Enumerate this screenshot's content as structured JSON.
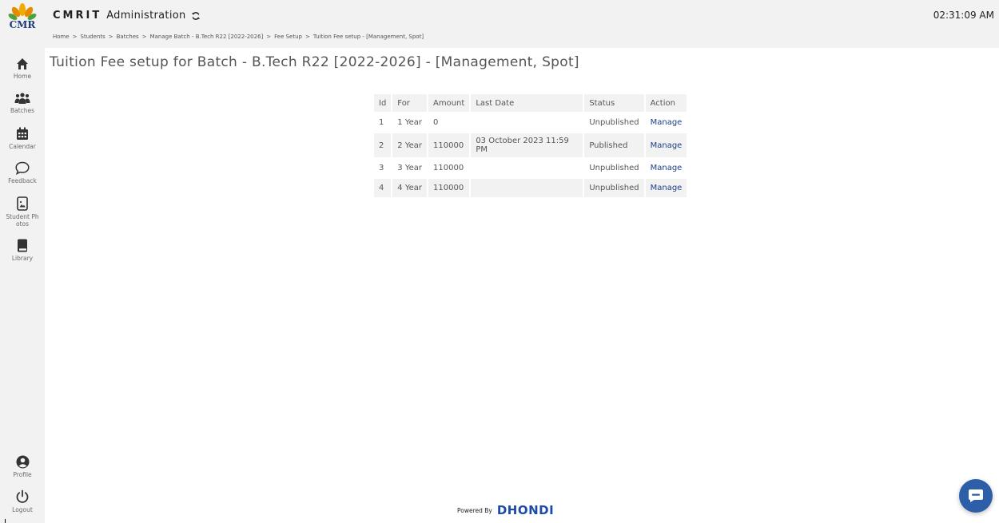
{
  "sidebar": {
    "logo_text": "CMR",
    "items": [
      {
        "label": "Home",
        "icon": "home-icon"
      },
      {
        "label": "Batches",
        "icon": "users-icon"
      },
      {
        "label": "Calendar",
        "icon": "calendar-icon"
      },
      {
        "label": "Feedback",
        "icon": "chat-bubble-icon"
      },
      {
        "label": "Student Ph otos",
        "icon": "photo-icon"
      },
      {
        "label": "Library",
        "icon": "book-icon"
      }
    ],
    "bottom_items": [
      {
        "label": "Profile",
        "icon": "profile-icon"
      },
      {
        "label": "Logout",
        "icon": "power-icon"
      }
    ]
  },
  "header": {
    "brand": "CMRIT",
    "title": "Administration",
    "time": "02:31:09 AM"
  },
  "breadcrumb": [
    "Home",
    "Students",
    "Batches",
    "Manage Batch - B.Tech R22 [2022-2026]",
    "Fee Setup",
    "Tuition Fee setup - [Management, Spot]"
  ],
  "breadcrumb_separator": ">",
  "page_title": "Tuition Fee setup for Batch - B.Tech R22 [2022-2026] - [Management, Spot]",
  "table": {
    "headers": [
      "Id",
      "For",
      "Amount",
      "Last Date",
      "Status",
      "Action"
    ],
    "rows": [
      {
        "id": "1",
        "for": "1 Year",
        "amount": "0",
        "last_date": "",
        "status": "Unpublished",
        "action": "Manage"
      },
      {
        "id": "2",
        "for": "2 Year",
        "amount": "110000",
        "last_date": "03 October 2023 11:59 PM",
        "status": "Published",
        "action": "Manage"
      },
      {
        "id": "3",
        "for": "3 Year",
        "amount": "110000",
        "last_date": "",
        "status": "Unpublished",
        "action": "Manage"
      },
      {
        "id": "4",
        "for": "4 Year",
        "amount": "110000",
        "last_date": "",
        "status": "Unpublished",
        "action": "Manage"
      }
    ]
  },
  "footer": {
    "powered_by": "Powered By",
    "brand": "DHONDI"
  },
  "colors": {
    "sidebar_bg": "#f2f2f2",
    "link": "#1d3d8a",
    "footer_brand": "#1e4aa8",
    "chat_button": "#2d5ea8"
  }
}
